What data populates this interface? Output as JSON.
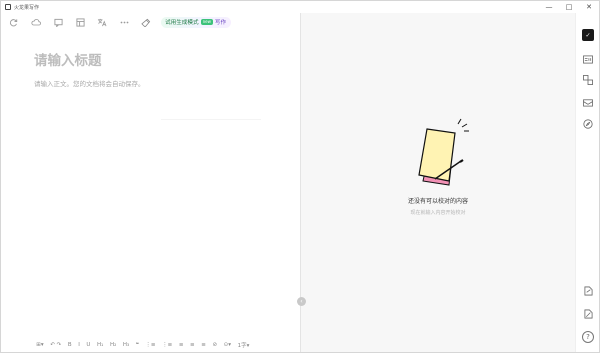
{
  "app": {
    "title": "火龙果写作"
  },
  "window_controls": {
    "minimize": "—",
    "maximize": "□",
    "close": "✕"
  },
  "toolbar": {
    "icons": [
      "refresh-icon",
      "cloud-icon",
      "comment-icon",
      "template-icon",
      "translate-icon",
      "more-icon",
      "brush-icon"
    ],
    "try_pill": {
      "prefix": "试用生成模式",
      "badge": "new",
      "suffix": "写作"
    }
  },
  "editor": {
    "title_placeholder": "请输入标题",
    "body_placeholder": "请输入正文。您的文档将会自动保存。"
  },
  "format_toolbar": {
    "items": [
      "⊞▾",
      "↶ ↷",
      "B",
      "I",
      "U",
      "H₁",
      "H₂",
      "H₃",
      "❝",
      "⋮≡",
      "⋮≡",
      "≡",
      "≡",
      "≡",
      "⊘",
      "⊙▾",
      "1字▾"
    ]
  },
  "right_panel": {
    "empty_title": "还没有可以校对的内容",
    "empty_subtitle": "现在就输入内容开始校对"
  },
  "sidebar": {
    "items": [
      "proofread-icon",
      "image-text-icon",
      "translate-icon",
      "mail-icon",
      "compass-icon",
      "export-icon",
      "edit-icon",
      "help-icon"
    ],
    "help_label": "?"
  },
  "colors": {
    "accent_green": "#3cc27a",
    "accent_purple": "#6a44c2",
    "pill_text": "#1f7a46",
    "sticky_yellow": "#fff3b3",
    "sticky_pink": "#f291b5"
  }
}
